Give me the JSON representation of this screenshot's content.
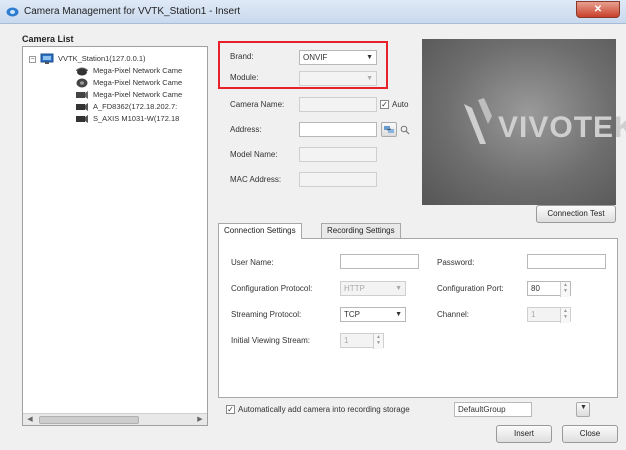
{
  "window": {
    "title": "Camera Management for VVTK_Station1 - Insert",
    "close_label": "✕"
  },
  "camera_list": {
    "title": "Camera List",
    "station": "VVTK_Station1(127.0.0.1)",
    "cameras": [
      {
        "label": "Mega-Pixel Network Came",
        "icon": "dome-camera-icon"
      },
      {
        "label": "Mega-Pixel Network Came",
        "icon": "dome-camera-icon"
      },
      {
        "label": "Mega-Pixel Network Came",
        "icon": "box-camera-icon"
      },
      {
        "label": "A_FD8362(172.18.202.7:",
        "icon": "box-camera-icon"
      },
      {
        "label": "S_AXIS M1031-W(172.18",
        "icon": "box-camera-icon"
      }
    ]
  },
  "form": {
    "brand_label": "Brand:",
    "brand_value": "ONVIF",
    "module_label": "Module:",
    "module_value": "",
    "camera_name_label": "Camera Name:",
    "camera_name_value": "",
    "auto_label": "Auto",
    "auto_checked": true,
    "address_label": "Address:",
    "address_value": "",
    "model_name_label": "Model Name:",
    "model_name_value": "",
    "mac_address_label": "MAC Address:",
    "mac_address_value": ""
  },
  "logo": {
    "text": "VIVOTEK"
  },
  "connection_test_label": "Connection Test",
  "tabs": [
    {
      "label": "Connection Settings",
      "active": true
    },
    {
      "label": "Recording Settings",
      "active": false
    }
  ],
  "connection": {
    "user_name_label": "User Name:",
    "user_name_value": "",
    "password_label": "Password:",
    "password_value": "",
    "config_protocol_label": "Configuration Protocol:",
    "config_protocol_value": "HTTP",
    "config_port_label": "Configuration Port:",
    "config_port_value": "80",
    "streaming_protocol_label": "Streaming Protocol:",
    "streaming_protocol_value": "TCP",
    "channel_label": "Channel:",
    "channel_value": "1",
    "initial_stream_label": "Initial Viewing Stream:",
    "initial_stream_value": "1"
  },
  "auto_add": {
    "label": "Automatically add camera into recording storage",
    "checked": true,
    "group_value": "DefaultGroup"
  },
  "buttons": {
    "insert": "Insert",
    "close": "Close"
  },
  "colors": {
    "highlight": "#e8202a",
    "logo_bg": "#6e6e6e"
  }
}
